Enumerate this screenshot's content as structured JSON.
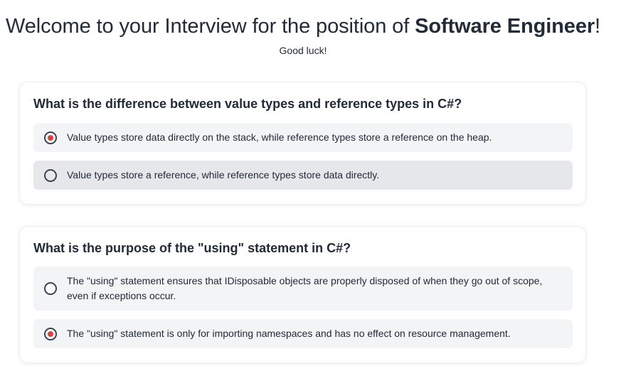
{
  "header": {
    "title_prefix": "Welcome to your Interview for the position of ",
    "title_role": "Software Engineer",
    "title_suffix": "!",
    "subtitle": "Good luck!"
  },
  "questions": [
    {
      "text": "What is the difference between value types and reference types in C#?",
      "options": [
        {
          "text": "Value types store data directly on the stack, while reference types store a reference on the heap.",
          "selected": true
        },
        {
          "text": "Value types store a reference, while reference types store data directly.",
          "selected": false
        }
      ]
    },
    {
      "text": "What is the purpose of the \"using\" statement in C#?",
      "options": [
        {
          "text": "The \"using\" statement ensures that IDisposable objects are properly disposed of when they go out of scope, even if exceptions occur.",
          "selected": false
        },
        {
          "text": "The \"using\" statement is only for importing namespaces and has no effect on resource management.",
          "selected": true
        }
      ]
    }
  ],
  "colors": {
    "text": "#222b38",
    "option_bg": "#f3f4f6",
    "option_hover_bg": "#e5e7eb",
    "radio_selected": "#e0403c"
  }
}
